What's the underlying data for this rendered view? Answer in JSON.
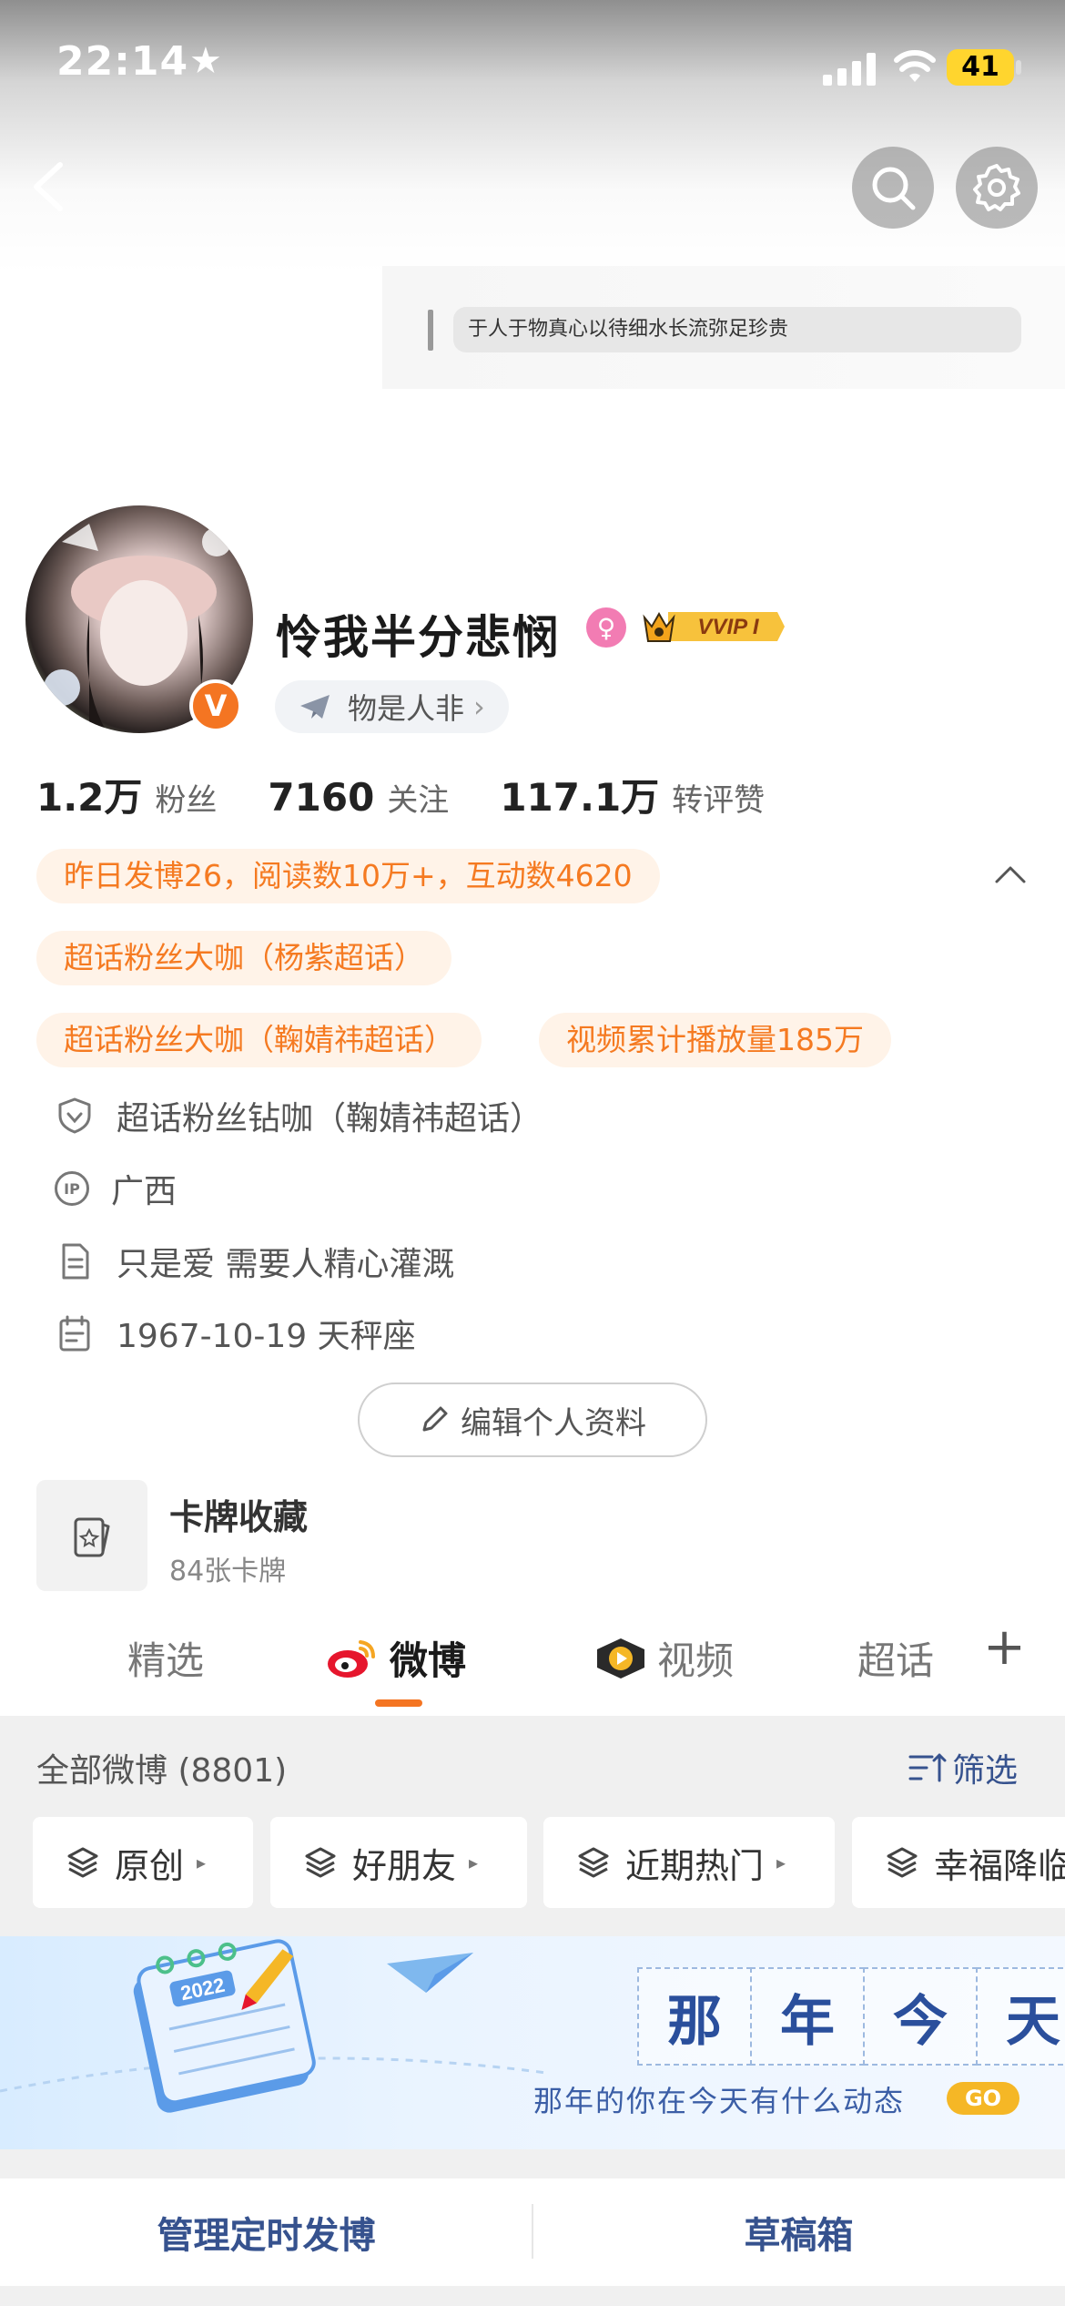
{
  "status_bar": {
    "time": "22:14",
    "battery": "41"
  },
  "motto": "于人于物真心以待细水长流弥足珍贵",
  "profile": {
    "username": "怜我半分悲悯",
    "verified_badge": "V",
    "gender_symbol": "♀",
    "vip_label": "VVIP I",
    "tag": "物是人非",
    "tag_arrow": "›"
  },
  "stats": [
    {
      "value": "1.2万",
      "label": "粉丝"
    },
    {
      "value": "7160",
      "label": "关注"
    },
    {
      "value": "117.1万",
      "label": "转评赞"
    }
  ],
  "highlights": {
    "yesterday": "昨日发博26，阅读数10万+，互动数4620",
    "pill1": "超话粉丝大咖（杨紫超话）",
    "pill2": "超话粉丝大咖（鞠婧祎超话）",
    "pill3": "视频累计播放量185万"
  },
  "info": {
    "diamond": "超话粉丝钻咖（鞠婧祎超话）",
    "ip_icon_text": "IP",
    "location": "广西",
    "bio": "只是爱 需要人精心灌溉",
    "birthday": "1967-10-19 天秤座"
  },
  "edit_profile": "编辑个人资料",
  "card_collection": {
    "title": "卡牌收藏",
    "subtitle": "84张卡牌"
  },
  "tabs": {
    "featured": "精选",
    "weibo": "微博",
    "video": "视频",
    "supertopic": "超话",
    "add": "+"
  },
  "feed": {
    "all_posts": "全部微博 (8801)",
    "filter": "筛选",
    "chips": [
      "原创",
      "好朋友",
      "近期热门",
      "幸福降临"
    ]
  },
  "banner": {
    "chars": [
      "那",
      "年",
      "今",
      "天"
    ],
    "subtitle": "那年的你在今天有什么动态",
    "go": "GO",
    "calendar_year": "2022"
  },
  "bottom": {
    "scheduled": "管理定时发博",
    "drafts": "草稿箱"
  },
  "colors": {
    "accent": "#f47522",
    "link": "#36528e",
    "pill_bg": "#fff3e8"
  }
}
